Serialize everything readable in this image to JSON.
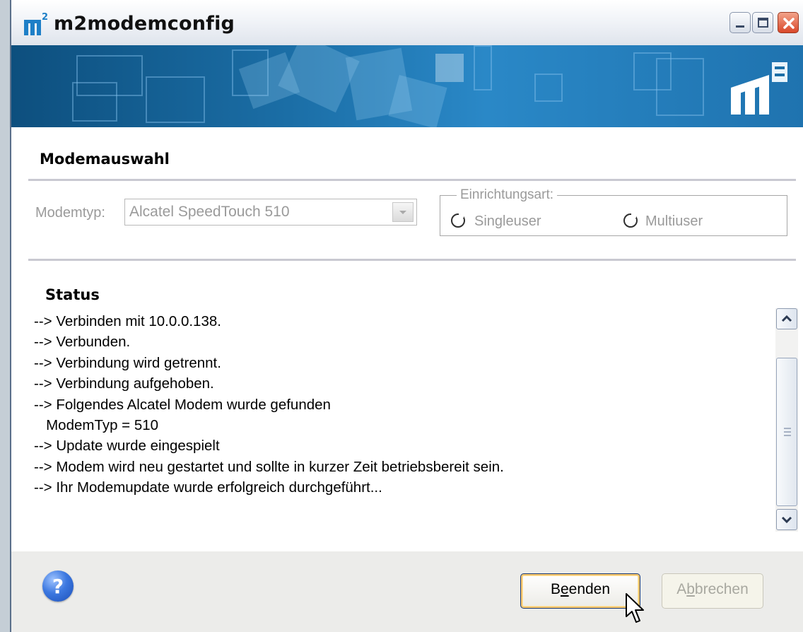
{
  "window": {
    "title": "m2modemconfig",
    "app_icon": "m2-logo-icon",
    "controls": [
      "minimize-icon",
      "maximize-icon",
      "close-icon"
    ]
  },
  "banner": {
    "logo": "m2-brand-logo"
  },
  "modem_section": {
    "heading": "Modemauswahl",
    "modemtype_label": "Modemtyp:",
    "modemtype_value": "Alcatel SpeedTouch 510",
    "setup_group_label": "Einrichtungsart:",
    "options": [
      {
        "label": "Singleuser",
        "selected": false
      },
      {
        "label": "Multiuser",
        "selected": false
      }
    ]
  },
  "status_section": {
    "heading": "Status",
    "log": [
      "--> Verbinden mit 10.0.0.138.",
      "--> Verbunden.",
      "--> Verbindung wird getrennt.",
      "--> Verbindung aufgehoben.",
      "--> Folgendes Alcatel Modem wurde gefunden",
      "   ModemTyp = 510",
      "--> Update wurde eingespielt",
      "--> Modem wird neu gestartet und sollte in kurzer Zeit betriebsbereit sein.",
      "--> Ihr Modemupdate wurde erfolgreich durchgeführt..."
    ]
  },
  "footer": {
    "help_icon": "help-icon",
    "finish_button": {
      "before": "B",
      "mnemonic": "e",
      "after": "enden"
    },
    "cancel_button": {
      "before": "A",
      "mnemonic": "b",
      "after": "brechen"
    }
  },
  "colors": {
    "banner_blue": "#1b6ea6",
    "disabled_text": "#9a9a9a",
    "default_button_ring": "#f5c46a"
  }
}
